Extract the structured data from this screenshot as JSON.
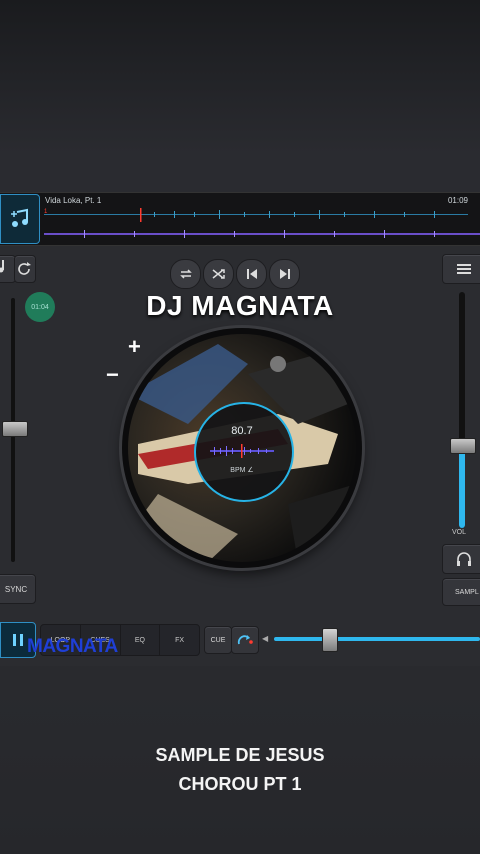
{
  "track": {
    "title": "Vida Loka, Pt. 1",
    "elapsed": "01:09"
  },
  "deck_left": {
    "timer": "01:04",
    "sync_label": "SYNC"
  },
  "overlay": {
    "dj_name": "DJ MAGNATA",
    "plus": "+",
    "minus": "−",
    "watermark": "MAGNATA",
    "caption_line1": "SAMPLE DE JESUS",
    "caption_line2": "CHOROU PT 1"
  },
  "turntable": {
    "bpm_value": "80.7",
    "bpm_label": "BPM ∠"
  },
  "deck_right": {
    "vol_label": "VOL",
    "sampler_label": "SAMPL"
  },
  "bottom": {
    "tabs": [
      "LOOP",
      "CUES",
      "EQ",
      "FX"
    ],
    "cue_label": "CUE"
  },
  "controls": {
    "volume_level": 0.33,
    "pitch_fader_level": 0.5,
    "crossfader_position": 0.28
  },
  "colors": {
    "accent": "#2fb8ee",
    "watermark": "#1f3fd6",
    "timer_badge": "#1f8a62"
  }
}
